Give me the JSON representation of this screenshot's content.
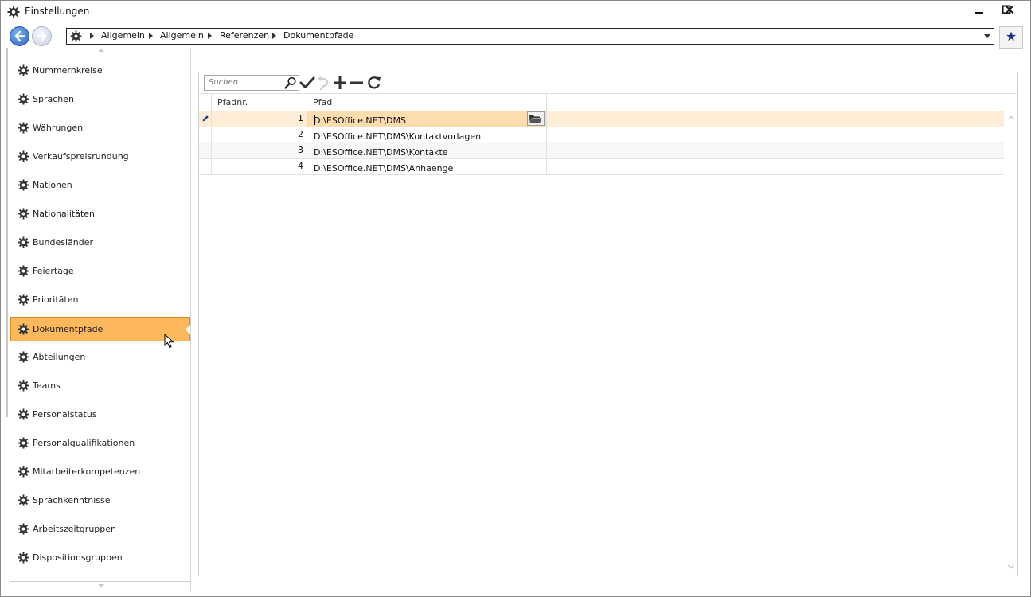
{
  "window": {
    "title": "Einstellungen",
    "controls": {
      "minimize": "—",
      "maximize": "□",
      "close": "✕"
    }
  },
  "breadcrumb": [
    "Allgemein",
    "Allgemein",
    "Referenzen",
    "Dokumentpfade"
  ],
  "icons": {
    "app": "gear-icon",
    "back": "arrow-left-icon",
    "forward": "arrow-right-icon",
    "favorite": "star-icon",
    "search": "magnifier-icon",
    "save": "checkmark-icon",
    "undo": "undo-icon",
    "add": "plus-icon",
    "remove": "minus-icon",
    "refresh": "refresh-icon",
    "folder": "folder-open-icon",
    "edit": "pencil-icon"
  },
  "favorite_glyph": "★",
  "sidebar": {
    "items": [
      {
        "label": "Nummernkreise"
      },
      {
        "label": "Sprachen"
      },
      {
        "label": "Währungen"
      },
      {
        "label": "Verkaufspreisrundung"
      },
      {
        "label": "Nationen"
      },
      {
        "label": "Nationalitäten"
      },
      {
        "label": "Bundesländer"
      },
      {
        "label": "Feiertage"
      },
      {
        "label": "Prioritäten"
      },
      {
        "label": "Dokumentpfade"
      },
      {
        "label": "Abteilungen"
      },
      {
        "label": "Teams"
      },
      {
        "label": "Personalstatus"
      },
      {
        "label": "Personalqualifikationen"
      },
      {
        "label": "Mitarbeiterkompetenzen"
      },
      {
        "label": "Sprachkenntnisse"
      },
      {
        "label": "Arbeitszeitgruppen"
      },
      {
        "label": "Dispositionsgruppen"
      }
    ],
    "active_index": 9
  },
  "grid": {
    "search_placeholder": "Suchen",
    "columns": [
      "Pfadnr.",
      "Pfad"
    ],
    "rows": [
      {
        "nr": "1",
        "pfad": "D:\\ESOffice.NET\\DMS"
      },
      {
        "nr": "2",
        "pfad": "D:\\ESOffice.NET\\DMS\\Kontaktvorlagen"
      },
      {
        "nr": "3",
        "pfad": "D:\\ESOffice.NET\\DMS\\Kontakte"
      },
      {
        "nr": "4",
        "pfad": "D:\\ESOffice.NET\\DMS\\Anhaenge"
      }
    ],
    "selected_row": 0
  },
  "colors": {
    "accent": "#fdb85c",
    "selection_row": "#fdecd6",
    "editing_cell": "#fddcb0",
    "nav_blue": "#2a64c4"
  }
}
